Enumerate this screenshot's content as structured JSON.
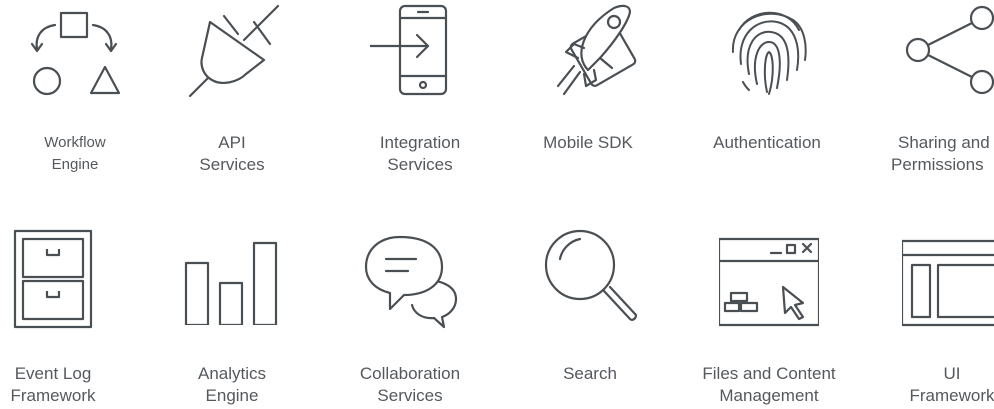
{
  "tiles": [
    {
      "id": "workflow",
      "icon": "workflow-icon",
      "line1": "Workflow",
      "line2": "Engine"
    },
    {
      "id": "api",
      "icon": "plug-icon",
      "line1": "API",
      "line2": "Services"
    },
    {
      "id": "integration",
      "icon": "phone-arrow-icon",
      "line1": "Integration",
      "line2": "Services"
    },
    {
      "id": "mobile-sdk",
      "icon": "rocket-phone-icon",
      "line1": "Mobile SDK",
      "line2": ""
    },
    {
      "id": "authentication",
      "icon": "fingerprint-icon",
      "line1": "Authentication",
      "line2": ""
    },
    {
      "id": "sharing",
      "icon": "share-icon",
      "line1": "Sharing and",
      "line2": "Permissions"
    },
    {
      "id": "event-log",
      "icon": "file-cabinet-icon",
      "line1": "Event Log",
      "line2": "Framework"
    },
    {
      "id": "analytics",
      "icon": "bar-chart-icon",
      "line1": "Analytics",
      "line2": "Engine"
    },
    {
      "id": "collaboration",
      "icon": "chat-bubbles-icon",
      "line1": "Collaboration",
      "line2": "Services"
    },
    {
      "id": "search",
      "icon": "magnifier-icon",
      "line1": "Search",
      "line2": ""
    },
    {
      "id": "files",
      "icon": "window-cursor-icon",
      "line1": "Files and Content",
      "line2": "Management"
    },
    {
      "id": "ui",
      "icon": "layout-icon",
      "line1": "UI",
      "line2": "Framework"
    }
  ],
  "colors": {
    "stroke": "#4a4f54",
    "text": "#55595e",
    "background": "#ffffff"
  }
}
